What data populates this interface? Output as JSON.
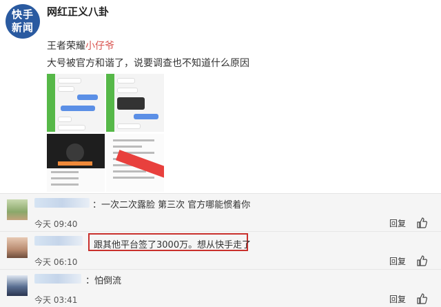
{
  "post": {
    "avatar_text_line1": "快手",
    "avatar_text_line2": "新闻",
    "author": "网红正义八卦",
    "line1_prefix": "王者荣耀",
    "line1_highlight": "小仔爷",
    "line2": "大号被官方和谐了，说要调查也不知道什么原因"
  },
  "comments": [
    {
      "text": "：一次二次露脸 第三次 官方哪能惯着你",
      "time": "今天 09:40",
      "reply_label": "回复",
      "highlighted": false
    },
    {
      "text": "跟其他平台签了3000万。想从快手走了",
      "time": "今天 06:10",
      "reply_label": "回复",
      "highlighted": true
    },
    {
      "text": "：怕倒流",
      "time": "今天 03:41",
      "reply_label": "回复",
      "highlighted": false
    }
  ],
  "icons": {
    "like": "thumbs-up-icon"
  },
  "colors": {
    "accent_red": "#c9302c",
    "name_highlight": "#d9534f",
    "avatar_blue": "#2a5aa0"
  }
}
